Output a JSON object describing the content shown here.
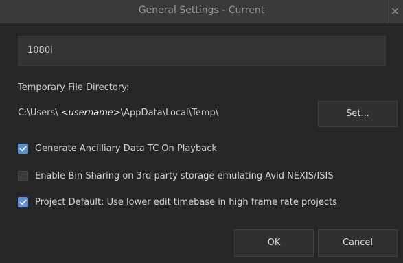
{
  "window": {
    "title": "General Settings - Current",
    "close_glyph": "✕"
  },
  "format": {
    "value": "1080i"
  },
  "temp_dir": {
    "label": "Temporary File Directory:",
    "path_prefix": "C:\\Users\\ ",
    "path_username": "<username>",
    "path_suffix": "\\AppData\\Local\\Temp\\",
    "set_label": "Set..."
  },
  "options": [
    {
      "label": "Generate Ancilliary Data TC On Playback",
      "checked": true
    },
    {
      "label": "Enable Bin Sharing on 3rd party storage emulating Avid NEXIS/ISIS",
      "checked": false
    },
    {
      "label": "Project Default: Use lower edit timebase in high frame rate projects",
      "checked": true
    }
  ],
  "footer": {
    "ok_label": "OK",
    "cancel_label": "Cancel"
  },
  "colors": {
    "accent": "#5b8fd8",
    "background": "#262626",
    "titlebar": "#3a3a3a"
  },
  "icons": {
    "close": "close-icon",
    "check": "checkmark-icon"
  }
}
